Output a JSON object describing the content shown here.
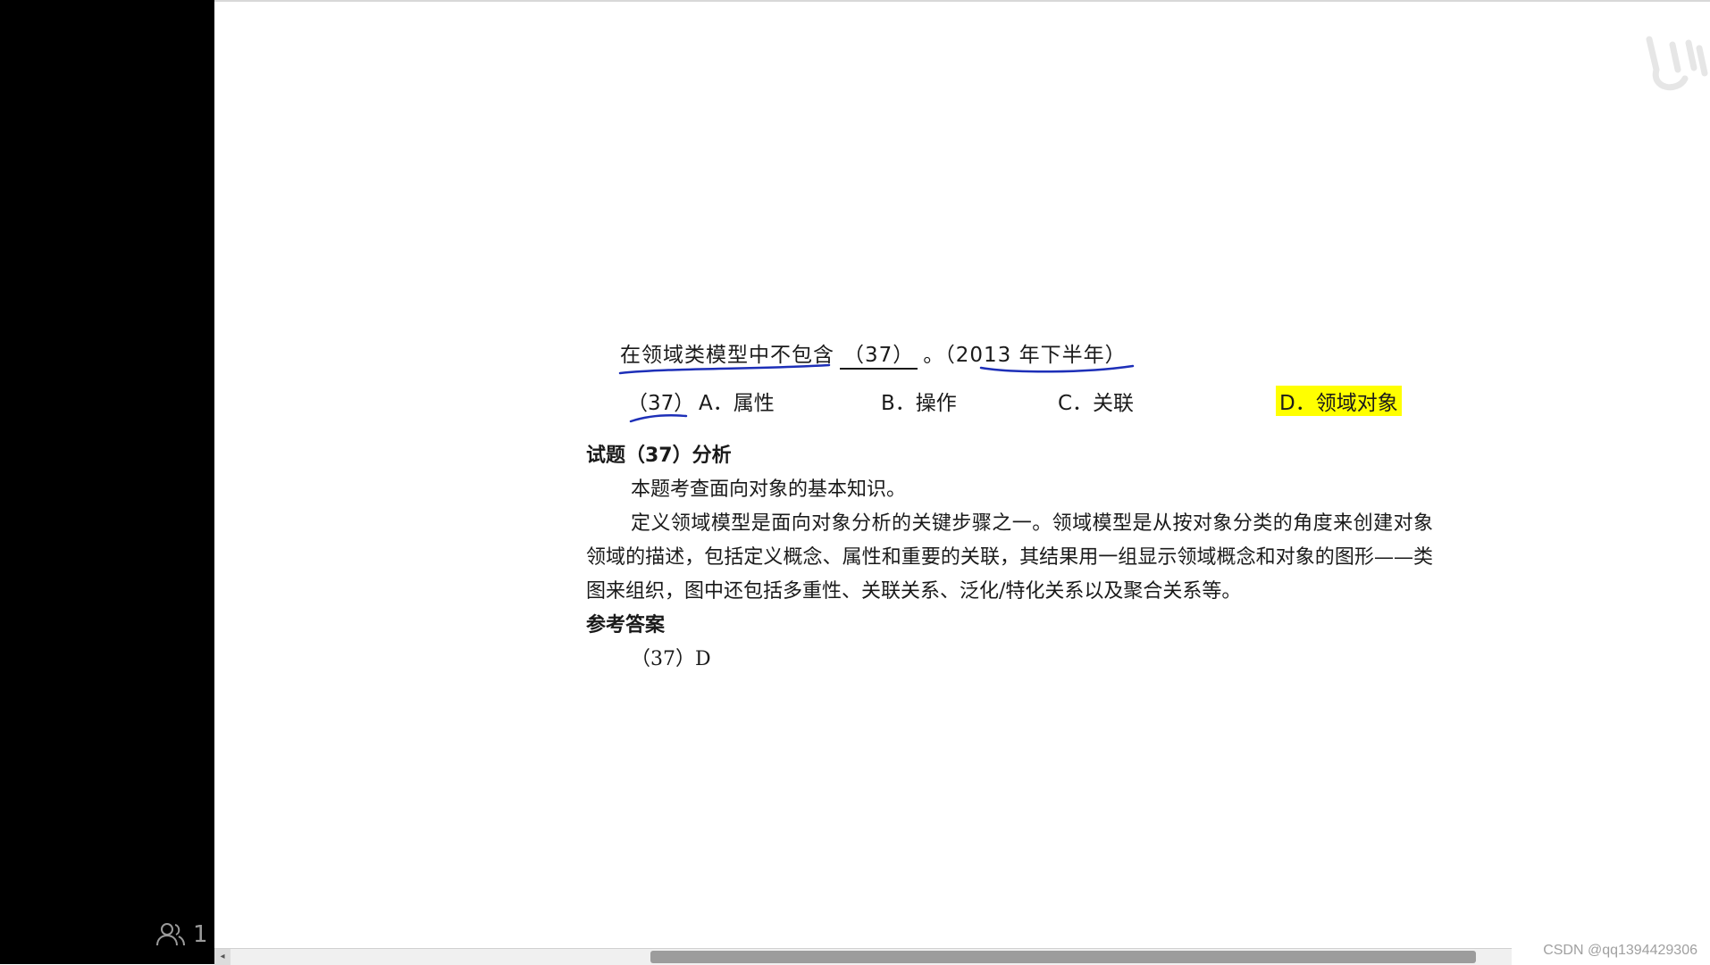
{
  "question": {
    "stem": "在领域类模型中不包含",
    "blank": "（37）",
    "tail": "。（2013 年下半年）"
  },
  "options": {
    "num": "（37）",
    "a": "A．属性",
    "b": "B．操作",
    "c": "C．关联",
    "d": "D．领域对象",
    "highlight_color": "#ffff00"
  },
  "analysis": {
    "heading": "试题（37）分析",
    "p1": "本题考查面向对象的基本知识。",
    "p2": "定义领域模型是面向对象分析的关键步骤之一。领域模型是从按对象分类的角度来创建对象领域的描述，包括定义概念、属性和重要的关联，其结果用一组显示领域概念和对象的图形——类图来组织，图中还包括多重性、关联关系、泛化/特化关系以及聚合关系等。",
    "answer_heading": "参考答案",
    "answer": "（37）D"
  },
  "viewer": {
    "count": "1",
    "icon": "people-icon"
  },
  "watermark": {
    "csdn": "CSDN @qq1394429306",
    "logo_icon": "bilibili-logo-icon"
  },
  "colors": {
    "pen": "#1d2fb8",
    "sidebar": "#000000"
  }
}
